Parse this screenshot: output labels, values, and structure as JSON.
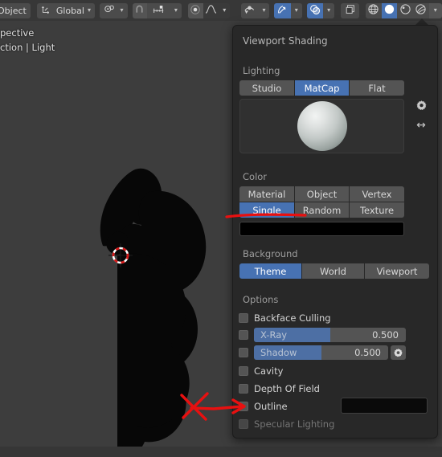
{
  "header": {
    "mode_label": "Object",
    "transform_orientation": "Global",
    "transform_orientation_icon": "orientation-axis-icon",
    "transform_chevron": "chevron-down-icon",
    "pivot_icon": "pivot-point-icon",
    "pivot_chevron": "chevron-down-icon",
    "snap_magnet_icon": "magnet-icon",
    "snap_to_icon": "snap-increment-icon",
    "snap_chevron": "chevron-down-icon",
    "proportional_icon": "proportional-edit-icon",
    "falloff_icon": "falloff-curve-icon",
    "falloff_chevron": "chevron-down-icon",
    "view_object_types_icon": "visibility-eye-icon",
    "view_object_types_chevron": "chevron-down-icon",
    "gizmo_icon": "gizmo-icon",
    "gizmo_chevron": "chevron-down-icon",
    "overlays_icon": "overlays-icon",
    "overlays_chevron": "chevron-down-icon",
    "xray_icon": "xray-toggle-icon",
    "shading_wireframe_icon": "shading-wireframe-icon",
    "shading_solid_icon": "shading-solid-icon",
    "shading_material_icon": "shading-material-preview-icon",
    "shading_rendered_icon": "shading-rendered-icon",
    "shading_chevron": "chevron-down-icon"
  },
  "viewport": {
    "info_line1": "pective",
    "info_line2": "ction | Light",
    "cursor_name": "3d-cursor"
  },
  "popover": {
    "title": "Viewport Shading",
    "lighting": {
      "label": "Lighting",
      "options": [
        "Studio",
        "MatCap",
        "Flat"
      ],
      "selected": "MatCap",
      "matcap_preview_name": "matcap-sphere-preview",
      "settings_icon": "gear-icon",
      "flip_icon": "flip-horizontal-icon"
    },
    "color": {
      "label": "Color",
      "options": [
        "Material",
        "Object",
        "Vertex",
        "Single",
        "Random",
        "Texture"
      ],
      "selected": "Single",
      "single_color": "#000000"
    },
    "background": {
      "label": "Background",
      "options": [
        "Theme",
        "World",
        "Viewport"
      ],
      "selected": "Theme"
    },
    "options": {
      "label": "Options",
      "backface_culling": {
        "label": "Backface Culling",
        "checked": false
      },
      "xray": {
        "label": "X-Ray",
        "checked": false,
        "value": "0.500",
        "fill_percent": 50
      },
      "shadow": {
        "label": "Shadow",
        "checked": false,
        "value": "0.500",
        "fill_percent": 50,
        "settings_icon": "gear-icon"
      },
      "cavity": {
        "label": "Cavity",
        "checked": false
      },
      "depth_of_field": {
        "label": "Depth Of Field",
        "checked": false
      },
      "outline": {
        "label": "Outline",
        "checked": false,
        "color": "#050505"
      },
      "specular_lighting": {
        "label": "Specular Lighting",
        "checked": false,
        "disabled": true
      }
    }
  },
  "annotations": {
    "color": "#e81010",
    "underline_name": "single-underline-annotation",
    "arrow_name": "outline-arrow-annotation"
  }
}
